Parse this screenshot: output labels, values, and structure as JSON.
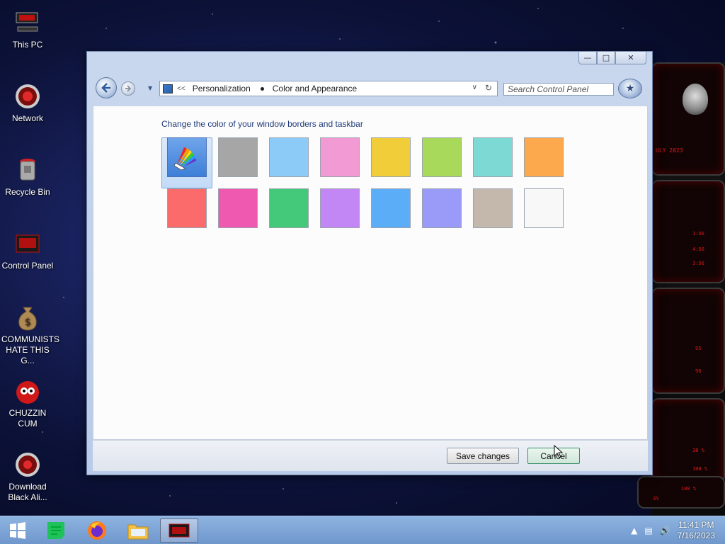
{
  "desktop": {
    "icons": [
      {
        "label": "This PC"
      },
      {
        "label": "Network"
      },
      {
        "label": "Recycle Bin"
      },
      {
        "label": "Control Panel"
      },
      {
        "label": "COMMUNISTS HATE THIS G..."
      },
      {
        "label": "CHUZZIN CUM"
      },
      {
        "label": "Download Black Ali..."
      }
    ]
  },
  "window": {
    "breadcrumb": {
      "overflow": "<<",
      "items": [
        "Personalization",
        "Color and Appearance"
      ]
    },
    "search": {
      "placeholder": "Search Control Panel"
    },
    "heading": "Change the color of your window borders and taskbar",
    "swatches": {
      "selected": "custom-palette",
      "row1": [
        "#a6a6a6",
        "#8ccbf8",
        "#f29ad3",
        "#f2cd3a",
        "#a9d95a",
        "#7dd9d4",
        "#fca84d"
      ],
      "row2": [
        "#fb6b6b",
        "#ef59b0",
        "#44c97a",
        "#c287f5",
        "#5badf8",
        "#9a9af8",
        "#c4b7ab",
        "#f8f8f8"
      ]
    },
    "buttons": {
      "save": "Save changes",
      "cancel": "Cancel"
    }
  },
  "taskbar": {
    "time": "11:41 PM",
    "date": "7/16/2023"
  },
  "gadgets": {
    "labels": [
      "ULY 2023",
      "1:56",
      "4:56",
      "3:56",
      "95",
      "96",
      "38 %",
      "108 %",
      "108 %",
      "3%"
    ]
  }
}
